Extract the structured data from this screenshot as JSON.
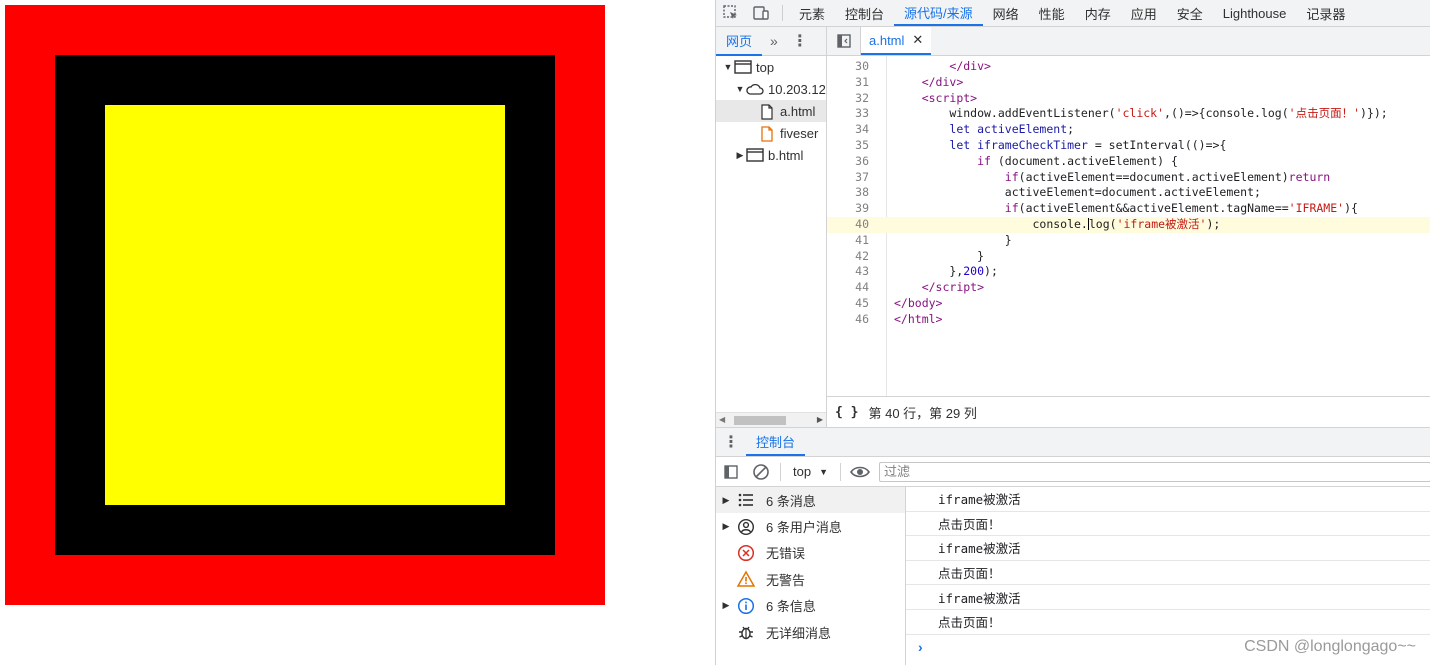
{
  "page": {
    "colors": {
      "outer": "#ff0000",
      "middle": "#000000",
      "inner": "#ffff00"
    }
  },
  "devtools": {
    "toolbar_icons": [
      "inspect-element-icon",
      "device-toolbar-icon"
    ],
    "main_tabs": [
      "元素",
      "控制台",
      "源代码/来源",
      "网络",
      "性能",
      "内存",
      "应用",
      "安全",
      "Lighthouse",
      "记录器"
    ],
    "active_main_tab": "源代码/来源",
    "sources": {
      "navigator_tab": "网页",
      "more_label": "»",
      "tree": [
        {
          "label": "top",
          "icon": "frame-icon",
          "indent": 0,
          "expanded": true
        },
        {
          "label": "10.203.12",
          "icon": "cloud-icon",
          "indent": 1,
          "expanded": true
        },
        {
          "label": "a.html",
          "icon": "file-icon",
          "indent": 2,
          "selected": true
        },
        {
          "label": "fiveser",
          "icon": "file-orange-icon",
          "indent": 2
        },
        {
          "label": "b.html",
          "icon": "frame-icon",
          "indent": 1,
          "expanded": false
        }
      ],
      "open_file": "a.html",
      "code_lines": [
        {
          "n": "30",
          "html": "        <span class=\"t\">&lt;/div&gt;</span>"
        },
        {
          "n": "31",
          "html": "    <span class=\"t\">&lt;/div&gt;</span>"
        },
        {
          "n": "32",
          "html": "    <span class=\"t\">&lt;script&gt;</span>"
        },
        {
          "n": "33",
          "html": "        window.addEventListener(<span class=\"str\">'click'</span>,()=&gt;{console.log(<span class=\"str\">'点击页面！'</span>)});"
        },
        {
          "n": "34",
          "html": "        <span class=\"kw\">let</span> <span class=\"kw\">activeElement</span>;"
        },
        {
          "n": "35",
          "html": "        <span class=\"kw\">let</span> <span class=\"kw\">iframeCheckTimer</span> = setInterval(()=&gt;{"
        },
        {
          "n": "36",
          "html": "            <span class=\"t\">if</span> (document.activeElement) {"
        },
        {
          "n": "37",
          "html": "                <span class=\"t\">if</span>(activeElement==document.activeElement)<span class=\"t\">return</span>"
        },
        {
          "n": "38",
          "html": "                activeElement=document.activeElement;"
        },
        {
          "n": "39",
          "html": "                <span class=\"t\">if</span>(activeElement&amp;&amp;activeElement.tagName==<span class=\"str\">'IFRAME'</span>){"
        },
        {
          "n": "40",
          "html": "                    console.<span class=\"caret\"></span>log(<span class=\"str\">'iframe被激活'</span>);",
          "highlight": true
        },
        {
          "n": "41",
          "html": "                }"
        },
        {
          "n": "42",
          "html": "            }"
        },
        {
          "n": "43",
          "html": "        },<span class=\"num\">200</span>);"
        },
        {
          "n": "44",
          "html": "    <span class=\"t\">&lt;/script&gt;</span>"
        },
        {
          "n": "45",
          "html": "<span class=\"t\">&lt;/body&gt;</span>"
        },
        {
          "n": "46",
          "html": "<span class=\"t\">&lt;/html&gt;</span>"
        }
      ],
      "status_braces": "{ }",
      "cursor_position": "第 40 行，第 29 列"
    },
    "drawer": {
      "tab": "控制台",
      "context": "top",
      "filter_placeholder": "过滤",
      "sidebar": [
        {
          "label": "6 条消息",
          "icon": "list-icon",
          "expandable": true,
          "selected": true
        },
        {
          "label": "6 条用户消息",
          "icon": "user-icon",
          "expandable": true
        },
        {
          "label": "无错误",
          "icon": "error-icon",
          "expandable": false
        },
        {
          "label": "无警告",
          "icon": "warning-icon",
          "expandable": false
        },
        {
          "label": "6 条信息",
          "icon": "info-icon",
          "expandable": true
        },
        {
          "label": "无详细消息",
          "icon": "bug-icon",
          "expandable": false
        }
      ],
      "messages": [
        "iframe被激活",
        "点击页面！",
        "iframe被激活",
        "点击页面！",
        "iframe被激活",
        "点击页面！"
      ],
      "prompt": "›"
    }
  },
  "watermark": "CSDN @longlongago~~"
}
